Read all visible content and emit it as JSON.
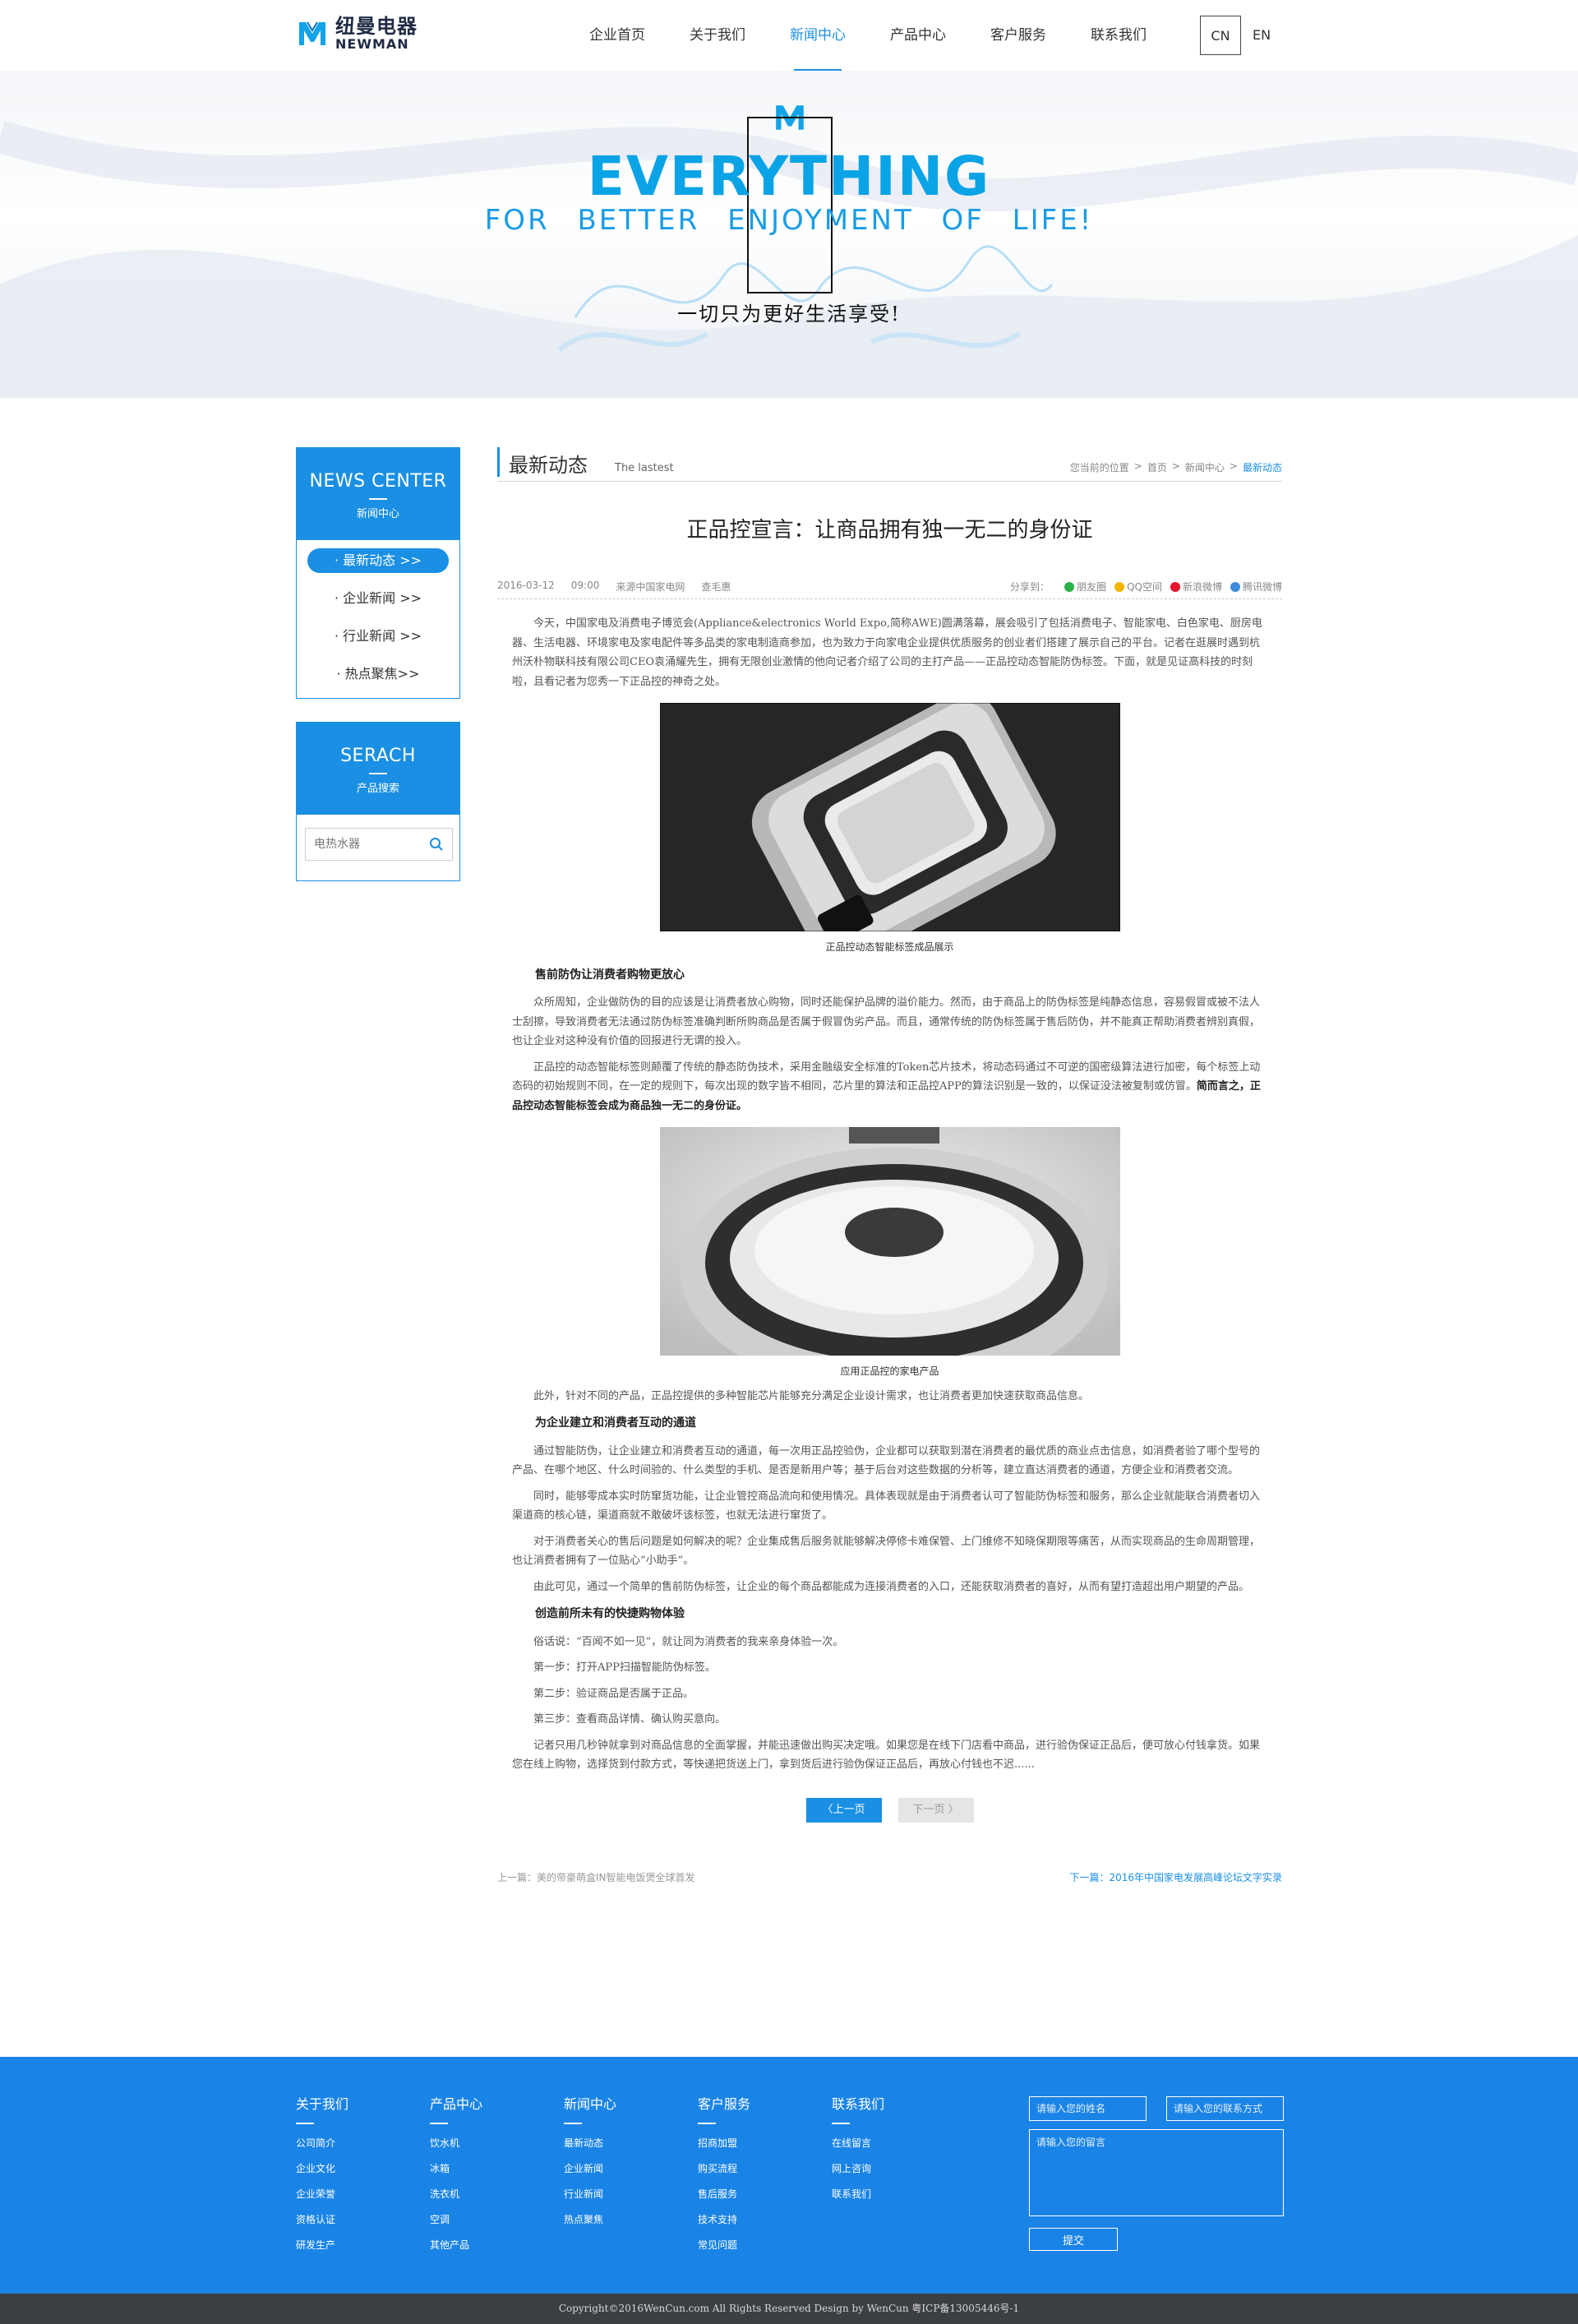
{
  "header": {
    "logo_cn": "纽曼电器",
    "logo_en": "NEWMAN",
    "nav": [
      {
        "label": "企业首页"
      },
      {
        "label": "关于我们"
      },
      {
        "label": "新闻中心"
      },
      {
        "label": "产品中心"
      },
      {
        "label": "客户服务"
      },
      {
        "label": "联系我们"
      }
    ],
    "active_nav": "新闻中心",
    "lang": {
      "cn": "CN",
      "en": "EN"
    }
  },
  "banner": {
    "title": "EVERYTHING",
    "subtitle": "FOR BETTER ENJOYMENT OF LIFE!",
    "tagline": "一切只为更好生活享受!"
  },
  "sidebar": {
    "news": {
      "title_en": "NEWS CENTER",
      "title_cn": "新闻中心",
      "items": [
        {
          "label": "· 最新动态 >>"
        },
        {
          "label": "· 企业新闻 >>"
        },
        {
          "label": "· 行业新闻 >>"
        },
        {
          "label": "· 热点聚焦>>"
        }
      ]
    },
    "search": {
      "title_en": "SERACH",
      "title_cn": "产品搜索",
      "placeholder": "电热水器"
    }
  },
  "main": {
    "section_title": "最新动态",
    "section_sub": "The lastest",
    "breadcrumb": [
      "您当前的位置",
      "首页",
      "新闻中心",
      "最新动态"
    ],
    "article": {
      "title": "正品控宣言：让商品拥有独一无二的身份证",
      "date": "2016-03-12",
      "time": "09:00",
      "source": "来源中国家电网",
      "author": "查毛惠",
      "share_label": "分享到：",
      "share": [
        {
          "label": "朋友圈",
          "color": "#2bb24c"
        },
        {
          "label": "QQ空间",
          "color": "#f4b400"
        },
        {
          "label": "新浪微博",
          "color": "#e6162d"
        },
        {
          "label": "腾讯微博",
          "color": "#3d8bd9"
        }
      ],
      "intro": "今天，中国家电及消费电子博览会(Appliance&electronics World Expo,简称AWE)圆满落幕，展会吸引了包括消费电子、智能家电、白色家电、厨房电器、生活电器、环境家电及家电配件等多品类的家电制造商参加，也为致力于向家电企业提供优质服务的创业者们搭建了展示自己的平台。记者在逛展时遇到杭州沃朴物联科技有限公司CEO袁涌耀先生，拥有无限创业激情的他向记者介绍了公司的主打产品——正品控动态智能防伪标签。下面，就是见证高科技的时刻啦，且看记者为您秀一下正品控的神奇之处。",
      "caption1": "正品控动态智能标签成品展示",
      "h1": "售前防伪让消费者购物更放心",
      "p1": "众所周知，企业做防伪的目的应该是让消费者放心购物，同时还能保护品牌的溢价能力。然而，由于商品上的防伪标签是纯静态信息，容易假冒或被不法人士刮擦，导致消费者无法通过防伪标签准确判断所购商品是否属于假冒伪劣产品。而且，通常传统的防伪标签属于售后防伪，并不能真正帮助消费者辨别真假，也让企业对这种没有价值的回报进行无谓的投入。",
      "p2": "正品控的动态智能标签则颠覆了传统的静态防伪技术，采用金融级安全标准的Token芯片技术，将动态码通过不可逆的国密级算法进行加密，每个标签上动态码的初始规则不同，在一定的规则下，每次出现的数字皆不相同，芯片里的算法和正品控APP的算法识别是一致的，以保证没法被复制或仿冒。",
      "p2_bold": "简而言之，正品控动态智能标签会成为商品独一无二的身份证。",
      "caption2": "应用正品控的家电产品",
      "p3": "此外，针对不同的产品，正品控提供的多种智能芯片能够充分满足企业设计需求，也让消费者更加快速获取商品信息。",
      "h2": "为企业建立和消费者互动的通道",
      "p4": "通过智能防伪，让企业建立和消费者互动的通道，每一次用正品控验伪，企业都可以获取到潜在消费者的最优质的商业点击信息，如消费者验了哪个型号的产品、在哪个地区、什么时间验的、什么类型的手机、是否是新用户等；基于后台对这些数据的分析等，建立直达消费者的通道，方便企业和消费者交流。",
      "p5": "同时，能够零成本实时防窜货功能，让企业管控商品流向和使用情况。具体表现就是由于消费者认可了智能防伪标签和服务，那么企业就能联合消费者切入渠道商的核心链，渠道商就不敢破坏该标签，也就无法进行窜货了。",
      "p6": "对于消费者关心的售后问题是如何解决的呢？企业集成售后服务就能够解决停修卡难保管、上门维修不知晓保期限等痛苦，从而实现商品的生命周期管理，也让消费者拥有了一位贴心“小助手”。",
      "p7": "由此可见，通过一个简单的售前防伪标签，让企业的每个商品都能成为连接消费者的入口，还能获取消费者的喜好，从而有望打造超出用户期望的产品。",
      "h3": "创造前所未有的快捷购物体验",
      "p8": "俗话说：“百闻不如一见”，就让同为消费者的我来亲身体验一次。",
      "p9": "第一步：打开APP扫描智能防伪标签。",
      "p10": "第二步：验证商品是否属于正品。",
      "p11": "第三步：查看商品详情、确认购买意向。",
      "p12": "记者只用几秒钟就拿到对商品信息的全面掌握，并能迅速做出购买决定哦。如果您是在线下门店看中商品，进行验伪保证正品后，便可放心付钱拿货。如果您在线上购物，选择货到付款方式，等快递把货送上门，拿到货后进行验伪保证正品后，再放心付钱也不迟......"
    },
    "pager": {
      "prev": "〈上一页",
      "next": "下一页 〉"
    },
    "adjacent": {
      "prev": "上一篇：美的帝豪萌盒IN智能电饭煲全球首发",
      "next": "下一篇：2016年中国家电发展高峰论坛文字实录"
    }
  },
  "footer": {
    "columns": [
      {
        "title": "关于我们",
        "links": [
          "公司简介",
          "企业文化",
          "企业荣誉",
          "资格认证",
          "研发生产"
        ]
      },
      {
        "title": "产品中心",
        "links": [
          "饮水机",
          "冰箱",
          "洗衣机",
          "空调",
          "其他产品"
        ]
      },
      {
        "title": "新闻中心",
        "links": [
          "最新动态",
          "企业新闻",
          "行业新闻",
          "热点聚焦"
        ]
      },
      {
        "title": "客户服务",
        "links": [
          "招商加盟",
          "购买流程",
          "售后服务",
          "技术支持",
          "常见问题"
        ]
      },
      {
        "title": "联系我们",
        "links": [
          "在线留言",
          "网上咨询",
          "联系我们"
        ]
      }
    ],
    "form": {
      "name_placeholder": "请输入您的姓名",
      "contact_placeholder": "请输入您的联系方式",
      "message_placeholder": "请输入您的留言",
      "submit": "提交"
    },
    "copyright": "Copyright©2016WenCun.com All Rights Reserved Design by WenCun 粤ICP备13005446号-1"
  },
  "colors": {
    "accent": "#1a8fe3",
    "footer": "#1a84e6",
    "banner_text": "#0aa3e6"
  }
}
